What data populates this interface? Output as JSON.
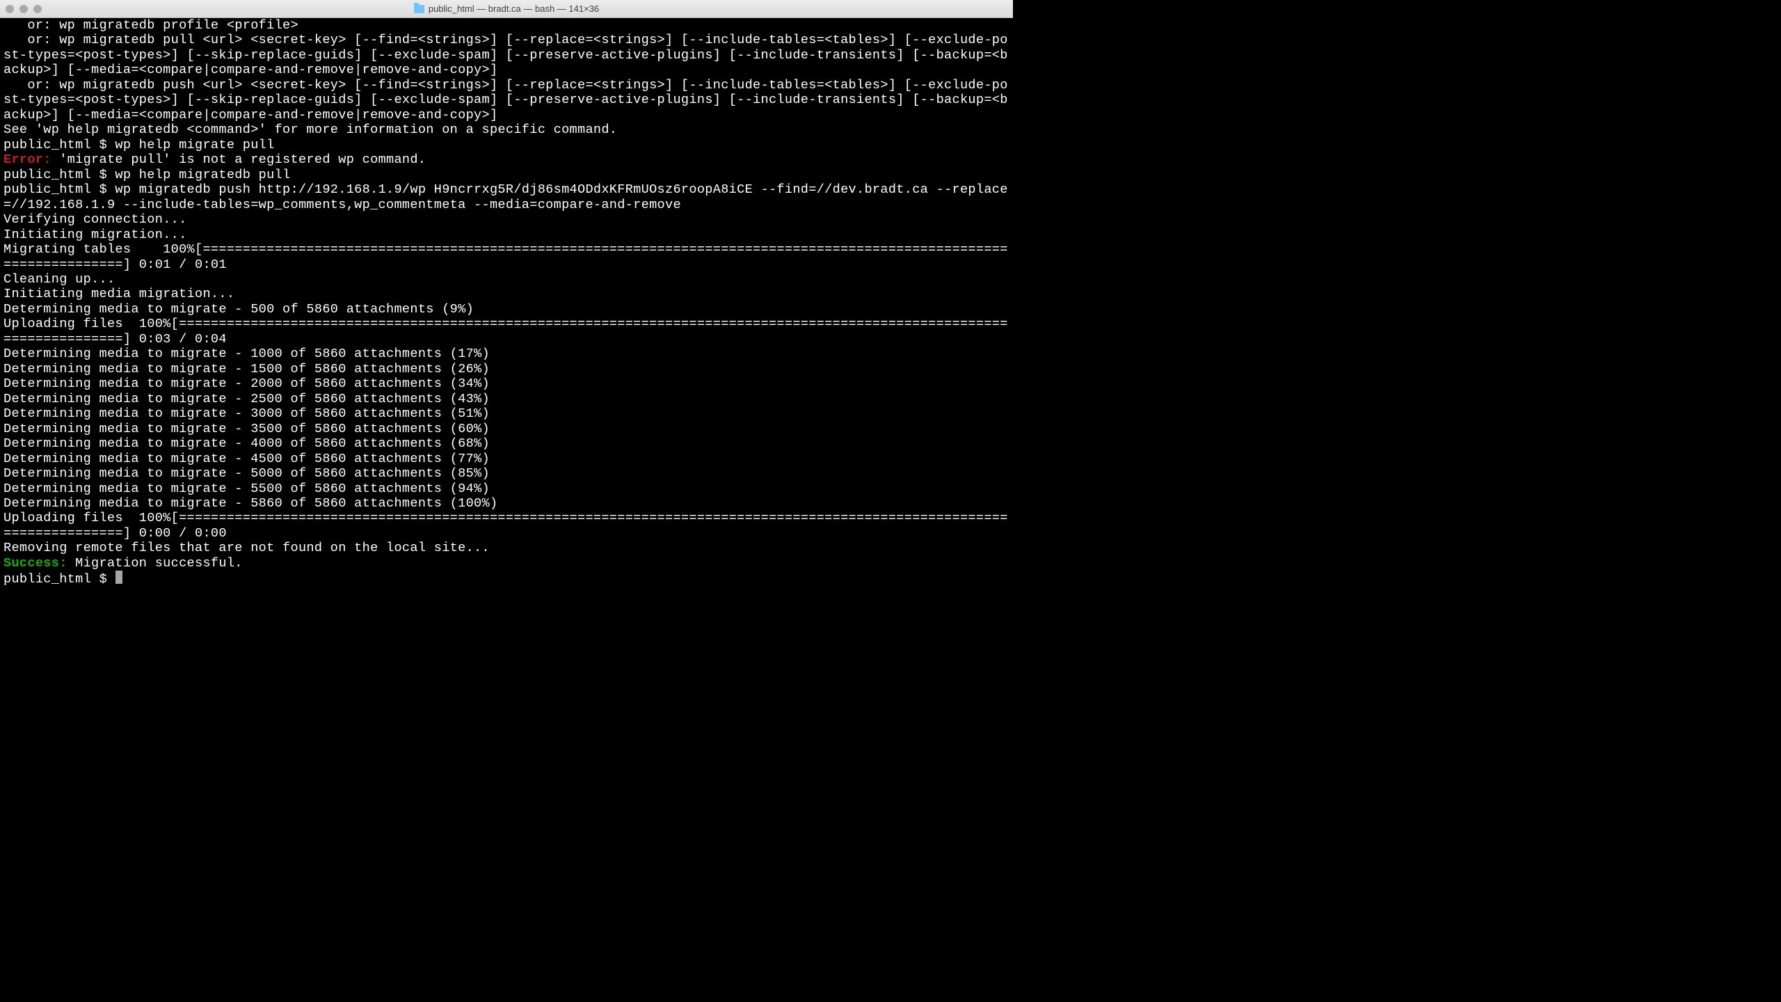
{
  "window": {
    "title": "public_html — bradt.ca — bash — 141×36"
  },
  "lines": {
    "l01": "   or: wp migratedb profile <profile>",
    "l02": "   or: wp migratedb pull <url> <secret-key> [--find=<strings>] [--replace=<strings>] [--include-tables=<tables>] [--exclude-post-types=<post-types>] [--skip-replace-guids] [--exclude-spam] [--preserve-active-plugins] [--include-transients] [--backup=<backup>] [--media=<compare|compare-and-remove|remove-and-copy>]",
    "l03": "   or: wp migratedb push <url> <secret-key> [--find=<strings>] [--replace=<strings>] [--include-tables=<tables>] [--exclude-post-types=<post-types>] [--skip-replace-guids] [--exclude-spam] [--preserve-active-plugins] [--include-transients] [--backup=<backup>] [--media=<compare|compare-and-remove|remove-and-copy>]",
    "l04": "",
    "l05": "See 'wp help migratedb <command>' for more information on a specific command.",
    "l06": "public_html $ wp help migrate pull",
    "l07a": "Error:",
    "l07b": " 'migrate pull' is not a registered wp command.",
    "l08": "public_html $ wp help migratedb pull",
    "l09": "public_html $ wp migratedb push http://192.168.1.9/wp H9ncrrxg5R/dj86sm4ODdxKFRmUOsz6roopA8iCE --find=//dev.bradt.ca --replace=//192.168.1.9 --include-tables=wp_comments,wp_commentmeta --media=compare-and-remove",
    "l10": "Verifying connection...",
    "l11": "Initiating migration...",
    "l12": "Migrating tables    100%[====================================================================================================================] 0:01 / 0:01",
    "l13": "Cleaning up...",
    "l14": "Initiating media migration...",
    "l15": "Determining media to migrate - 500 of 5860 attachments (9%)",
    "l16": "Uploading files  100%[=======================================================================================================================] 0:03 / 0:04",
    "l17": "Determining media to migrate - 1000 of 5860 attachments (17%)",
    "l18": "Determining media to migrate - 1500 of 5860 attachments (26%)",
    "l19": "Determining media to migrate - 2000 of 5860 attachments (34%)",
    "l20": "Determining media to migrate - 2500 of 5860 attachments (43%)",
    "l21": "Determining media to migrate - 3000 of 5860 attachments (51%)",
    "l22": "Determining media to migrate - 3500 of 5860 attachments (60%)",
    "l23": "Determining media to migrate - 4000 of 5860 attachments (68%)",
    "l24": "Determining media to migrate - 4500 of 5860 attachments (77%)",
    "l25": "Determining media to migrate - 5000 of 5860 attachments (85%)",
    "l26": "Determining media to migrate - 5500 of 5860 attachments (94%)",
    "l27": "Determining media to migrate - 5860 of 5860 attachments (100%)",
    "l28": "Uploading files  100%[=======================================================================================================================] 0:00 / 0:00",
    "l29": "Removing remote files that are not found on the local site...",
    "l30a": "Success:",
    "l30b": " Migration successful.",
    "l31": "public_html $ "
  }
}
